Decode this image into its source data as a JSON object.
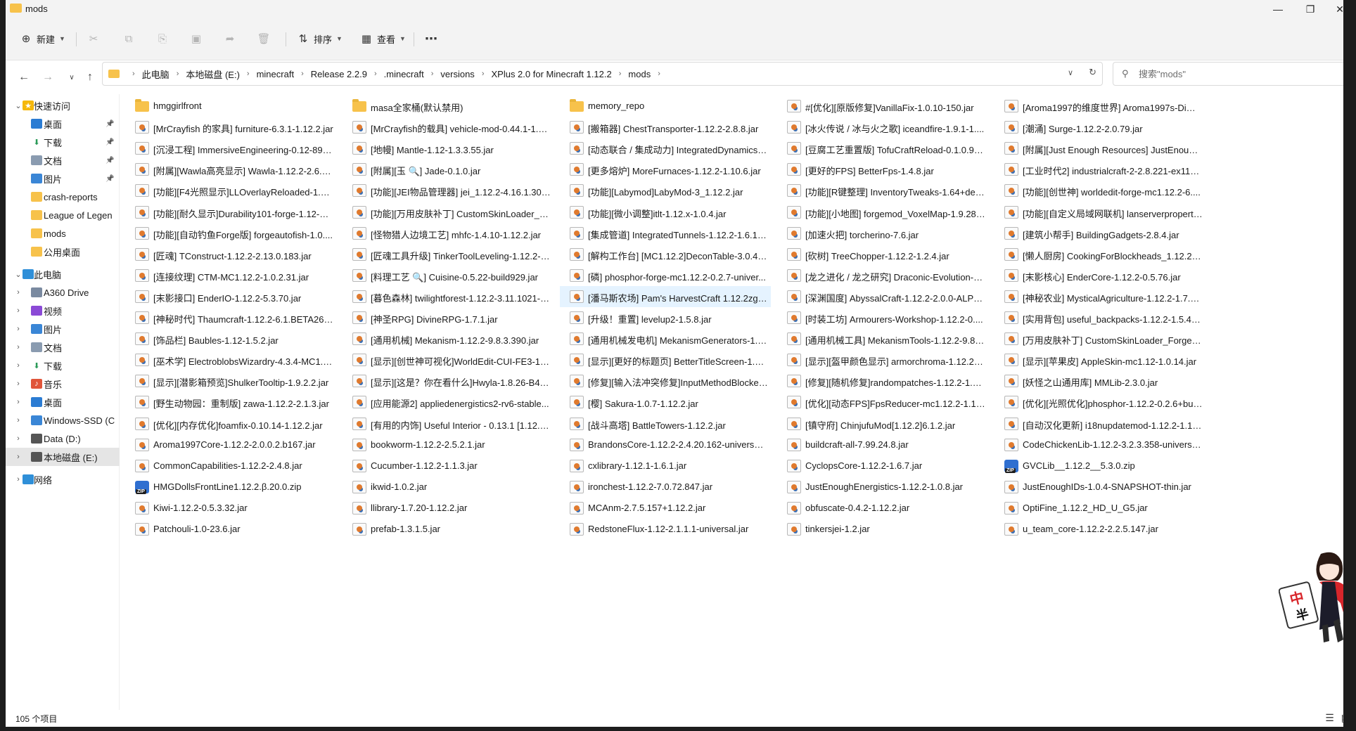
{
  "window": {
    "title": "mods",
    "min_icon": "minimize-icon",
    "max_icon": "maximize-icon",
    "close_icon": "close-icon"
  },
  "toolbar": {
    "new_label": "新建",
    "sort_label": "排序",
    "view_label": "查看"
  },
  "address": {
    "crumbs": [
      "此电脑",
      "本地磁盘 (E:)",
      "minecraft",
      "Release 2.2.9",
      ".minecraft",
      "versions",
      "XPlus 2.0 for Minecraft 1.12.2",
      "mods"
    ]
  },
  "search": {
    "placeholder": "搜索\"mods\""
  },
  "sidebar": {
    "items": [
      {
        "label": "快速访问",
        "icon": "star-icon"
      },
      {
        "label": "桌面",
        "icon": "desktop-icon",
        "pinned": true
      },
      {
        "label": "下载",
        "icon": "download-icon",
        "pinned": true
      },
      {
        "label": "文档",
        "icon": "document-icon",
        "pinned": true
      },
      {
        "label": "图片",
        "icon": "picture-icon",
        "pinned": true
      },
      {
        "label": "crash-reports",
        "icon": "folder-icon"
      },
      {
        "label": "League of Legen",
        "icon": "folder-icon"
      },
      {
        "label": "mods",
        "icon": "folder-icon"
      },
      {
        "label": "公用桌面",
        "icon": "folder-icon"
      },
      {
        "label": "此电脑",
        "icon": "computer-icon"
      },
      {
        "label": "A360 Drive",
        "icon": "cloud-drive-icon"
      },
      {
        "label": "视频",
        "icon": "video-icon"
      },
      {
        "label": "图片",
        "icon": "picture-icon"
      },
      {
        "label": "文档",
        "icon": "document-icon"
      },
      {
        "label": "下载",
        "icon": "download-icon"
      },
      {
        "label": "音乐",
        "icon": "music-icon"
      },
      {
        "label": "桌面",
        "icon": "desktop-icon"
      },
      {
        "label": "Windows-SSD (C",
        "icon": "windows-drive-icon"
      },
      {
        "label": "Data (D:)",
        "icon": "drive-icon"
      },
      {
        "label": "本地磁盘 (E:)",
        "icon": "drive-icon"
      },
      {
        "label": "网络",
        "icon": "network-icon"
      }
    ]
  },
  "files": [
    {
      "name": "hmggirlfront",
      "type": "folder"
    },
    {
      "name": "masa全家桶(默认禁用)",
      "type": "folder"
    },
    {
      "name": "memory_repo",
      "type": "folder"
    },
    {
      "name": "#[优化][原版修复]VanillaFix-1.0.10-150.jar",
      "type": "jar"
    },
    {
      "name": "[Aroma1997的维度世界] Aroma1997s-Dime...",
      "type": "jar"
    },
    {
      "name": "[MrCrayfish 的家具] furniture-6.3.1-1.12.2.jar",
      "type": "jar"
    },
    {
      "name": "[MrCrayfish的载具] vehicle-mod-0.44.1-1.1...",
      "type": "jar"
    },
    {
      "name": "[搬箱器] ChestTransporter-1.12.2-2.8.8.jar",
      "type": "jar"
    },
    {
      "name": "[冰火传说 / 冰与火之歌] iceandfire-1.9.1-1....",
      "type": "jar"
    },
    {
      "name": "[潮涌] Surge-1.12.2-2.0.79.jar",
      "type": "jar"
    },
    {
      "name": "[沉浸工程] ImmersiveEngineering-0.12-89.jar",
      "type": "jar"
    },
    {
      "name": "[地幔] Mantle-1.12-1.3.3.55.jar",
      "type": "jar"
    },
    {
      "name": "[动态联合 / 集成动力] IntegratedDynamics-...",
      "type": "jar"
    },
    {
      "name": "[豆腐工艺重置版] TofuCraftReload-0.1.0.9.jar",
      "type": "jar"
    },
    {
      "name": "[附属][Just Enough Resources] JustEnough...",
      "type": "jar"
    },
    {
      "name": "[附属][Wawla高亮显示] Wawla-1.12.2-2.6.27....",
      "type": "jar"
    },
    {
      "name": "[附属][玉 🔍] Jade-0.1.0.jar",
      "type": "jar"
    },
    {
      "name": "[更多熔炉] MoreFurnaces-1.12.2-1.10.6.jar",
      "type": "jar"
    },
    {
      "name": "[更好的FPS] BetterFps-1.4.8.jar",
      "type": "jar"
    },
    {
      "name": "[工业时代2] industrialcraft-2-2.8.221-ex112....",
      "type": "jar"
    },
    {
      "name": "[功能][F4光照显示]LLOverlayReloaded-1.1.6....",
      "type": "jar"
    },
    {
      "name": "[功能][JEI物品管理器] jei_1.12.2-4.16.1.302.jar",
      "type": "jar"
    },
    {
      "name": "[功能][Labymod]LabyMod-3_1.12.2.jar",
      "type": "jar"
    },
    {
      "name": "[功能][R键整理] InventoryTweaks-1.64+dev....",
      "type": "jar"
    },
    {
      "name": "[功能][创世神] worldedit-forge-mc1.12.2-6....",
      "type": "jar"
    },
    {
      "name": "[功能][耐久显示]Durability101-forge-1.12-0....",
      "type": "jar"
    },
    {
      "name": "[功能][万用皮肤补丁] CustomSkinLoader_Fo...",
      "type": "jar"
    },
    {
      "name": "[功能][微小调整]itlt-1.12.x-1.0.4.jar",
      "type": "jar"
    },
    {
      "name": "[功能][小地图] forgemod_VoxelMap-1.9.28_...",
      "type": "jar"
    },
    {
      "name": "[功能][自定义局域网联机] lanserverproperti...",
      "type": "jar"
    },
    {
      "name": "[功能][自动钓鱼Forge版] forgeautofish-1.0....",
      "type": "jar"
    },
    {
      "name": "[怪物猎人边境工艺] mhfc-1.4.10-1.12.2.jar",
      "type": "jar"
    },
    {
      "name": "[集成管道] IntegratedTunnels-1.12.2-1.6.14....",
      "type": "jar"
    },
    {
      "name": "[加速火把] torcherino-7.6.jar",
      "type": "jar"
    },
    {
      "name": "[建筑小帮手] BuildingGadgets-2.8.4.jar",
      "type": "jar"
    },
    {
      "name": "[匠魂] TConstruct-1.12.2-2.13.0.183.jar",
      "type": "jar"
    },
    {
      "name": "[匠魂工具升级] TinkerToolLeveling-1.12.2-1....",
      "type": "jar"
    },
    {
      "name": "[解构工作台] [MC1.12.2]DeconTable-3.0.4.jar",
      "type": "jar"
    },
    {
      "name": "[砍树] TreeChopper-1.12.2-1.2.4.jar",
      "type": "jar"
    },
    {
      "name": "[懒人厨房] CookingForBlockheads_1.12.2-6...",
      "type": "jar"
    },
    {
      "name": "[连接纹理] CTM-MC1.12.2-1.0.2.31.jar",
      "type": "jar"
    },
    {
      "name": "[料理工艺 🔍] Cuisine-0.5.22-build929.jar",
      "type": "jar"
    },
    {
      "name": "[磷] phosphor-forge-mc1.12.2-0.2.7-univer...",
      "type": "jar"
    },
    {
      "name": "[龙之进化 / 龙之研究] Draconic-Evolution-1....",
      "type": "jar"
    },
    {
      "name": "[末影核心] EnderCore-1.12.2-0.5.76.jar",
      "type": "jar"
    },
    {
      "name": "[末影接口] EnderIO-1.12.2-5.3.70.jar",
      "type": "jar"
    },
    {
      "name": "[暮色森林] twilightforest-1.12.2-3.11.1021-u...",
      "type": "jar"
    },
    {
      "name": "[潘马斯农场] Pam's HarvestCraft 1.12.2zg.jar",
      "type": "jar",
      "selected": true
    },
    {
      "name": "[深渊国度] AbyssalCraft-1.12.2-2.0.0-ALPHA...",
      "type": "jar"
    },
    {
      "name": "[神秘农业] MysticalAgriculture-1.12.2-1.7.5.j...",
      "type": "jar"
    },
    {
      "name": "[神秘时代] Thaumcraft-1.12.2-6.1.BETA26.jar",
      "type": "jar"
    },
    {
      "name": "[神圣RPG] DivineRPG-1.7.1.jar",
      "type": "jar"
    },
    {
      "name": "[升级！重置] levelup2-1.5.8.jar",
      "type": "jar"
    },
    {
      "name": "[时装工坊] Armourers-Workshop-1.12.2-0....",
      "type": "jar"
    },
    {
      "name": "[实用背包] useful_backpacks-1.12.2-1.5.4.8...",
      "type": "jar"
    },
    {
      "name": "[饰品栏] Baubles-1.12-1.5.2.jar",
      "type": "jar"
    },
    {
      "name": "[通用机械] Mekanism-1.12.2-9.8.3.390.jar",
      "type": "jar"
    },
    {
      "name": "[通用机械发电机] MekanismGenerators-1.1...",
      "type": "jar"
    },
    {
      "name": "[通用机械工具] MekanismTools-1.12.2-9.8.3....",
      "type": "jar"
    },
    {
      "name": "[万用皮肤补丁] CustomSkinLoader_ForgeLe...",
      "type": "jar"
    },
    {
      "name": "[巫术学] ElectroblobsWizardry-4.3.4-MC1.1....",
      "type": "jar"
    },
    {
      "name": "[显示][创世神可视化]WorldEdit-CUI-FE3-1.1...",
      "type": "jar"
    },
    {
      "name": "[显示][更好的标题页] BetterTitleScreen-1.12....",
      "type": "jar"
    },
    {
      "name": "[显示][盔甲颜色显示] armorchroma-1.12.2-1...",
      "type": "jar"
    },
    {
      "name": "[显示][苹果皮] AppleSkin-mc1.12-1.0.14.jar",
      "type": "jar"
    },
    {
      "name": "[显示][潜影箱预览]ShulkerTooltip-1.9.2.2.jar",
      "type": "jar"
    },
    {
      "name": "[显示][这是？你在看什么]Hwyla-1.8.26-B41_...",
      "type": "jar"
    },
    {
      "name": "[修复][输入法冲突修复]InputMethodBlocker...",
      "type": "jar"
    },
    {
      "name": "[修复][随机修复]randompatches-1.12.2-1.22....",
      "type": "jar"
    },
    {
      "name": "[妖怪之山通用库] MMLib-2.3.0.jar",
      "type": "jar"
    },
    {
      "name": "[野生动物园：重制版] zawa-1.12.2-2.1.3.jar",
      "type": "jar"
    },
    {
      "name": "[应用能源2] appliedenergistics2-rv6-stable...",
      "type": "jar"
    },
    {
      "name": "[樱] Sakura-1.0.7-1.12.2.jar",
      "type": "jar"
    },
    {
      "name": "[优化][动态FPS]FpsReducer-mc1.12.2-1.18.jar",
      "type": "jar"
    },
    {
      "name": "[优化][光照优化]phosphor-1.12.2-0.2.6+buil...",
      "type": "jar"
    },
    {
      "name": "[优化][内存优化]foamfix-0.10.14-1.12.2.jar",
      "type": "jar"
    },
    {
      "name": "[有用的内饰] Useful Interior - 0.13.1 [1.12.2....",
      "type": "jar"
    },
    {
      "name": "[战斗高塔] BattleTowers-1.12.2.jar",
      "type": "jar"
    },
    {
      "name": "[镇守府] ChinjufuMod[1.12.2]6.1.2.jar",
      "type": "jar"
    },
    {
      "name": "[自动汉化更新] i18nupdatemod-1.12.2-1.1.0....",
      "type": "jar"
    },
    {
      "name": "Aroma1997Core-1.12.2-2.0.0.2.b167.jar",
      "type": "jar"
    },
    {
      "name": "bookworm-1.12.2-2.5.2.1.jar",
      "type": "jar"
    },
    {
      "name": "BrandonsCore-1.12.2-2.4.20.162-universal....",
      "type": "jar"
    },
    {
      "name": "buildcraft-all-7.99.24.8.jar",
      "type": "jar"
    },
    {
      "name": "CodeChickenLib-1.12.2-3.2.3.358-universal....",
      "type": "jar"
    },
    {
      "name": "CommonCapabilities-1.12.2-2.4.8.jar",
      "type": "jar"
    },
    {
      "name": "Cucumber-1.12.2-1.1.3.jar",
      "type": "jar"
    },
    {
      "name": "cxlibrary-1.12.1-1.6.1.jar",
      "type": "jar"
    },
    {
      "name": "CyclopsCore-1.12.2-1.6.7.jar",
      "type": "jar"
    },
    {
      "name": "GVCLib__1.12.2__5.3.0.zip",
      "type": "zip"
    },
    {
      "name": "HMGDollsFrontLine1.12.2.β.20.0.zip",
      "type": "zip"
    },
    {
      "name": "ikwid-1.0.2.jar",
      "type": "jar"
    },
    {
      "name": "ironchest-1.12.2-7.0.72.847.jar",
      "type": "jar"
    },
    {
      "name": "JustEnoughEnergistics-1.12.2-1.0.8.jar",
      "type": "jar"
    },
    {
      "name": "JustEnoughIDs-1.0.4-SNAPSHOT-thin.jar",
      "type": "jar"
    },
    {
      "name": "Kiwi-1.12.2-0.5.3.32.jar",
      "type": "jar"
    },
    {
      "name": "llibrary-1.7.20-1.12.2.jar",
      "type": "jar"
    },
    {
      "name": "MCAnm-2.7.5.157+1.12.2.jar",
      "type": "jar"
    },
    {
      "name": "obfuscate-0.4.2-1.12.2.jar",
      "type": "jar"
    },
    {
      "name": "OptiFine_1.12.2_HD_U_G5.jar",
      "type": "jar"
    },
    {
      "name": "Patchouli-1.0-23.6.jar",
      "type": "jar"
    },
    {
      "name": "prefab-1.3.1.5.jar",
      "type": "jar"
    },
    {
      "name": "RedstoneFlux-1.12-2.1.1.1-universal.jar",
      "type": "jar"
    },
    {
      "name": "tinkersjei-1.2.jar",
      "type": "jar"
    },
    {
      "name": "u_team_core-1.12.2-2.2.5.147.jar",
      "type": "jar"
    }
  ],
  "status": {
    "count": "105 个项目"
  },
  "sticker": {
    "text": "中半"
  }
}
